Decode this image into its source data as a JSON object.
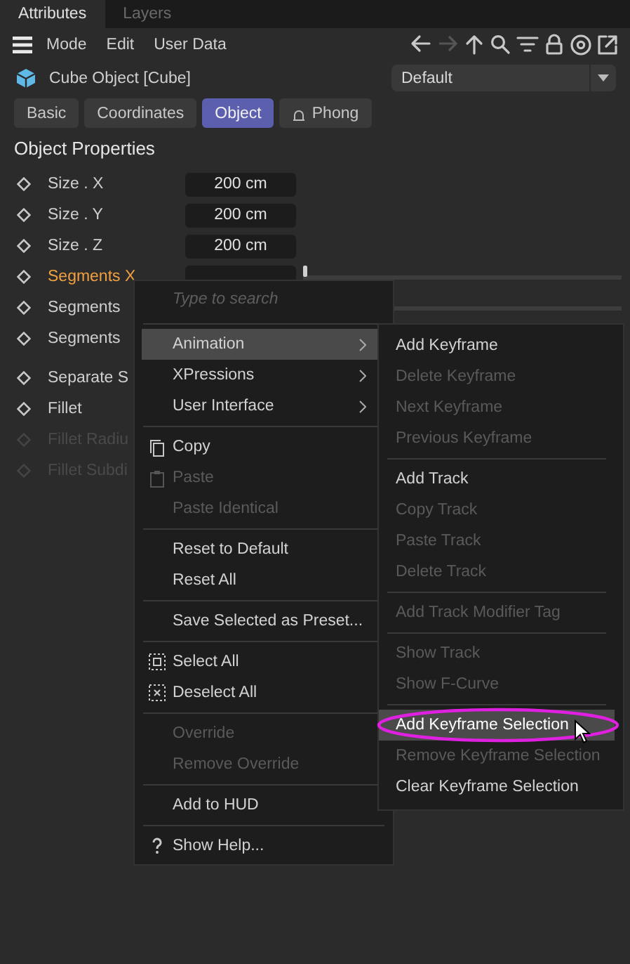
{
  "panel_tabs": [
    {
      "label": "Attributes",
      "selected": true
    },
    {
      "label": "Layers",
      "selected": false
    }
  ],
  "menubar": {
    "items": [
      "Mode",
      "Edit",
      "User Data"
    ]
  },
  "object": {
    "title": "Cube Object [Cube]",
    "preset": "Default"
  },
  "tabs": [
    {
      "label": "Basic",
      "selected": false,
      "kind": "plain"
    },
    {
      "label": "Coordinates",
      "selected": false,
      "kind": "plain"
    },
    {
      "label": "Object",
      "selected": true,
      "kind": "plain"
    },
    {
      "label": "Phong",
      "selected": false,
      "kind": "phong"
    }
  ],
  "section": "Object Properties",
  "property_groups": [
    [
      {
        "label": "Size . X",
        "value": "200 cm",
        "disabled": false,
        "active": false
      },
      {
        "label": "Size . Y",
        "value": "200 cm",
        "disabled": false,
        "active": false
      },
      {
        "label": "Size . Z",
        "value": "200 cm",
        "disabled": false,
        "active": false
      },
      {
        "label": "Segments X",
        "disabled": false,
        "active": true,
        "level": 0
      },
      {
        "label": "Segments",
        "disabled": false,
        "active": false,
        "level": 0
      },
      {
        "label": "Segments",
        "disabled": false,
        "active": false
      }
    ],
    [
      {
        "label": "Separate S",
        "disabled": false,
        "active": false
      },
      {
        "label": "Fillet",
        "disabled": false,
        "active": false
      },
      {
        "label": "Fillet Radiu",
        "disabled": true,
        "active": false
      },
      {
        "label": "Fillet Subdi",
        "disabled": true,
        "active": false
      }
    ]
  ],
  "context_menu": {
    "placeholder": "Type to search",
    "groups": [
      [
        {
          "label": "Animation",
          "kind": "submenu",
          "disabled": false,
          "selected": true
        },
        {
          "label": "XPressions",
          "kind": "submenu",
          "disabled": false,
          "selected": false
        },
        {
          "label": "User Interface",
          "kind": "submenu",
          "disabled": false,
          "selected": false
        }
      ],
      [
        {
          "label": "Copy",
          "kind": "copy",
          "disabled": false,
          "selected": false
        },
        {
          "label": "Paste",
          "kind": "paste",
          "disabled": true,
          "selected": false
        },
        {
          "label": "Paste Identical",
          "kind": "item",
          "disabled": true,
          "selected": false
        }
      ],
      [
        {
          "label": "Reset to Default",
          "kind": "item",
          "disabled": false,
          "selected": false
        },
        {
          "label": "Reset All",
          "kind": "item",
          "disabled": false,
          "selected": false
        }
      ],
      [
        {
          "label": "Save Selected as Preset...",
          "kind": "item",
          "disabled": false,
          "selected": false
        }
      ],
      [
        {
          "label": "Select All",
          "kind": "select",
          "disabled": false,
          "selected": false
        },
        {
          "label": "Deselect All",
          "kind": "deselect",
          "disabled": false,
          "selected": false
        }
      ],
      [
        {
          "label": "Override",
          "kind": "item",
          "disabled": true,
          "selected": false
        },
        {
          "label": "Remove Override",
          "kind": "item",
          "disabled": true,
          "selected": false
        }
      ],
      [
        {
          "label": "Add to HUD",
          "kind": "item",
          "disabled": false,
          "selected": false
        }
      ],
      [
        {
          "label": "Show Help...",
          "kind": "help",
          "disabled": false,
          "selected": false
        }
      ]
    ]
  },
  "submenu": {
    "groups": [
      [
        {
          "label": "Add Keyframe",
          "disabled": false,
          "selected": false
        },
        {
          "label": "Delete Keyframe",
          "disabled": true,
          "selected": false
        },
        {
          "label": "Next Keyframe",
          "disabled": true,
          "selected": false
        },
        {
          "label": "Previous Keyframe",
          "disabled": true,
          "selected": false
        }
      ],
      [
        {
          "label": "Add Track",
          "disabled": false,
          "selected": false
        },
        {
          "label": "Copy Track",
          "disabled": true,
          "selected": false
        },
        {
          "label": "Paste Track",
          "disabled": true,
          "selected": false
        },
        {
          "label": "Delete Track",
          "disabled": true,
          "selected": false
        }
      ],
      [
        {
          "label": "Add Track Modifier Tag",
          "disabled": true,
          "selected": false
        }
      ],
      [
        {
          "label": "Show Track",
          "disabled": true,
          "selected": false
        },
        {
          "label": "Show F-Curve",
          "disabled": true,
          "selected": false
        }
      ],
      [
        {
          "label": "Add Keyframe Selection",
          "disabled": false,
          "selected": true,
          "annotated": true
        },
        {
          "label": "Remove Keyframe Selection",
          "disabled": true,
          "selected": false
        },
        {
          "label": "Clear Keyframe Selection",
          "disabled": false,
          "selected": false
        }
      ]
    ]
  }
}
